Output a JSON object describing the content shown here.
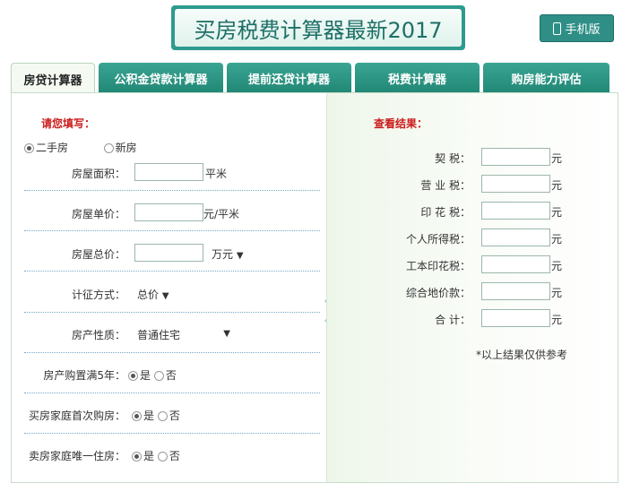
{
  "header": {
    "title": "买房税费计算器最新2017",
    "mobile_button": "手机版"
  },
  "tabs": [
    {
      "label": "房贷计算器",
      "active": true
    },
    {
      "label": "公积金贷款计算器",
      "active": false
    },
    {
      "label": "提前还贷计算器",
      "active": false
    },
    {
      "label": "税费计算器",
      "active": false
    },
    {
      "label": "购房能力评估",
      "active": false
    }
  ],
  "left": {
    "section_title": "请您填写：",
    "house_type": {
      "options": [
        "二手房",
        "新房"
      ],
      "selected": "二手房"
    },
    "area": {
      "label": "房屋面积：",
      "value": "",
      "unit": "平米"
    },
    "unit_price": {
      "label": "房屋单价：",
      "value": "",
      "unit": "元/平米"
    },
    "total_price": {
      "label": "房屋总价：",
      "value": "",
      "unit": "万元"
    },
    "tax_basis": {
      "label": "计征方式：",
      "value": "总价"
    },
    "property_type": {
      "label": "房产性质：",
      "value": "普通住宅"
    },
    "over_5_years": {
      "label": "房产购置满5年：",
      "yes": "是",
      "no": "否",
      "selected": "是"
    },
    "first_home": {
      "label": "买房家庭首次购房：",
      "yes": "是",
      "no": "否",
      "selected": "是"
    },
    "only_home": {
      "label": "卖房家庭唯一住房：",
      "yes": "是",
      "no": "否",
      "selected": "是"
    }
  },
  "right": {
    "section_title": "查看结果：",
    "results": [
      {
        "label": "契 税：",
        "value": "",
        "unit": "元"
      },
      {
        "label": "营 业 税：",
        "value": "",
        "unit": "元"
      },
      {
        "label": "印 花 税：",
        "value": "",
        "unit": "元"
      },
      {
        "label": "个人所得税：",
        "value": "",
        "unit": "元"
      },
      {
        "label": "工本印花税：",
        "value": "",
        "unit": "元"
      },
      {
        "label": "综合地价款：",
        "value": "",
        "unit": "元"
      },
      {
        "label": "合 计：",
        "value": "",
        "unit": "元"
      }
    ],
    "note": "*以上结果仅供参考"
  }
}
